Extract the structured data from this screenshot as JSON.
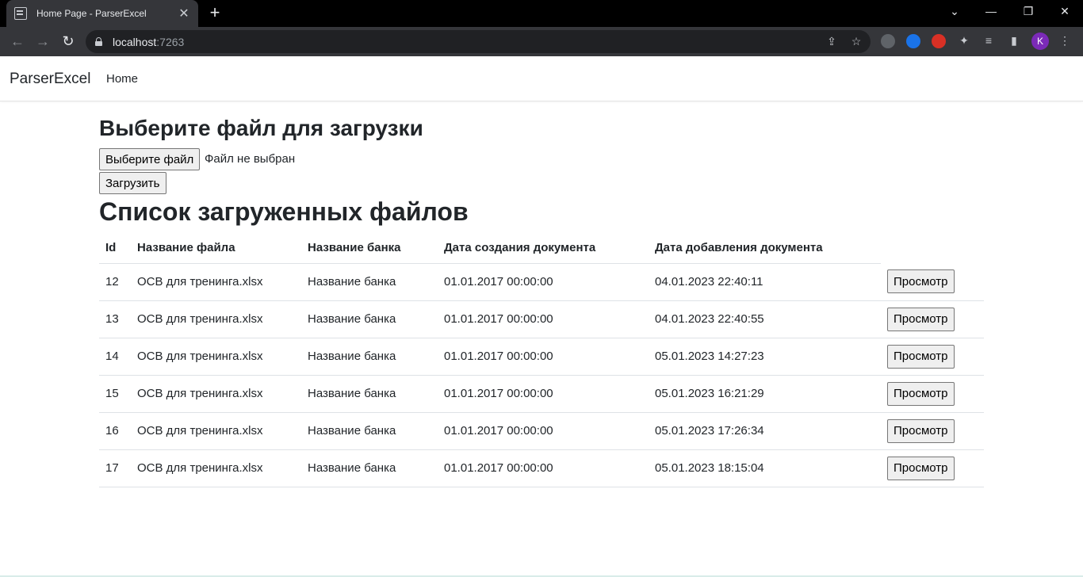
{
  "browser": {
    "tab_title": "Home Page - ParserExcel",
    "url_host": "localhost",
    "url_port": ":7263",
    "avatar_initial": "K"
  },
  "navbar": {
    "brand": "ParserExcel",
    "home_link": "Home"
  },
  "upload": {
    "title": "Выберите файл для загрузки",
    "choose_file_label": "Выберите файл",
    "no_file_text": "Файл не выбран",
    "upload_label": "Загрузить"
  },
  "files": {
    "title": "Список загруженных файлов",
    "columns": [
      "Id",
      "Название файла",
      "Название банка",
      "Дата создания документа",
      "Дата добавления документа"
    ],
    "view_label": "Просмотр",
    "rows": [
      {
        "id": "12",
        "file": "ОСВ для тренинга.xlsx",
        "bank": "Название банка",
        "created": "01.01.2017 00:00:00",
        "added": "04.01.2023 22:40:11"
      },
      {
        "id": "13",
        "file": "ОСВ для тренинга.xlsx",
        "bank": "Название банка",
        "created": "01.01.2017 00:00:00",
        "added": "04.01.2023 22:40:55"
      },
      {
        "id": "14",
        "file": "ОСВ для тренинга.xlsx",
        "bank": "Название банка",
        "created": "01.01.2017 00:00:00",
        "added": "05.01.2023 14:27:23"
      },
      {
        "id": "15",
        "file": "ОСВ для тренинга.xlsx",
        "bank": "Название банка",
        "created": "01.01.2017 00:00:00",
        "added": "05.01.2023 16:21:29"
      },
      {
        "id": "16",
        "file": "ОСВ для тренинга.xlsx",
        "bank": "Название банка",
        "created": "01.01.2017 00:00:00",
        "added": "05.01.2023 17:26:34"
      },
      {
        "id": "17",
        "file": "ОСВ для тренинга.xlsx",
        "bank": "Название банка",
        "created": "01.01.2017 00:00:00",
        "added": "05.01.2023 18:15:04"
      }
    ]
  }
}
